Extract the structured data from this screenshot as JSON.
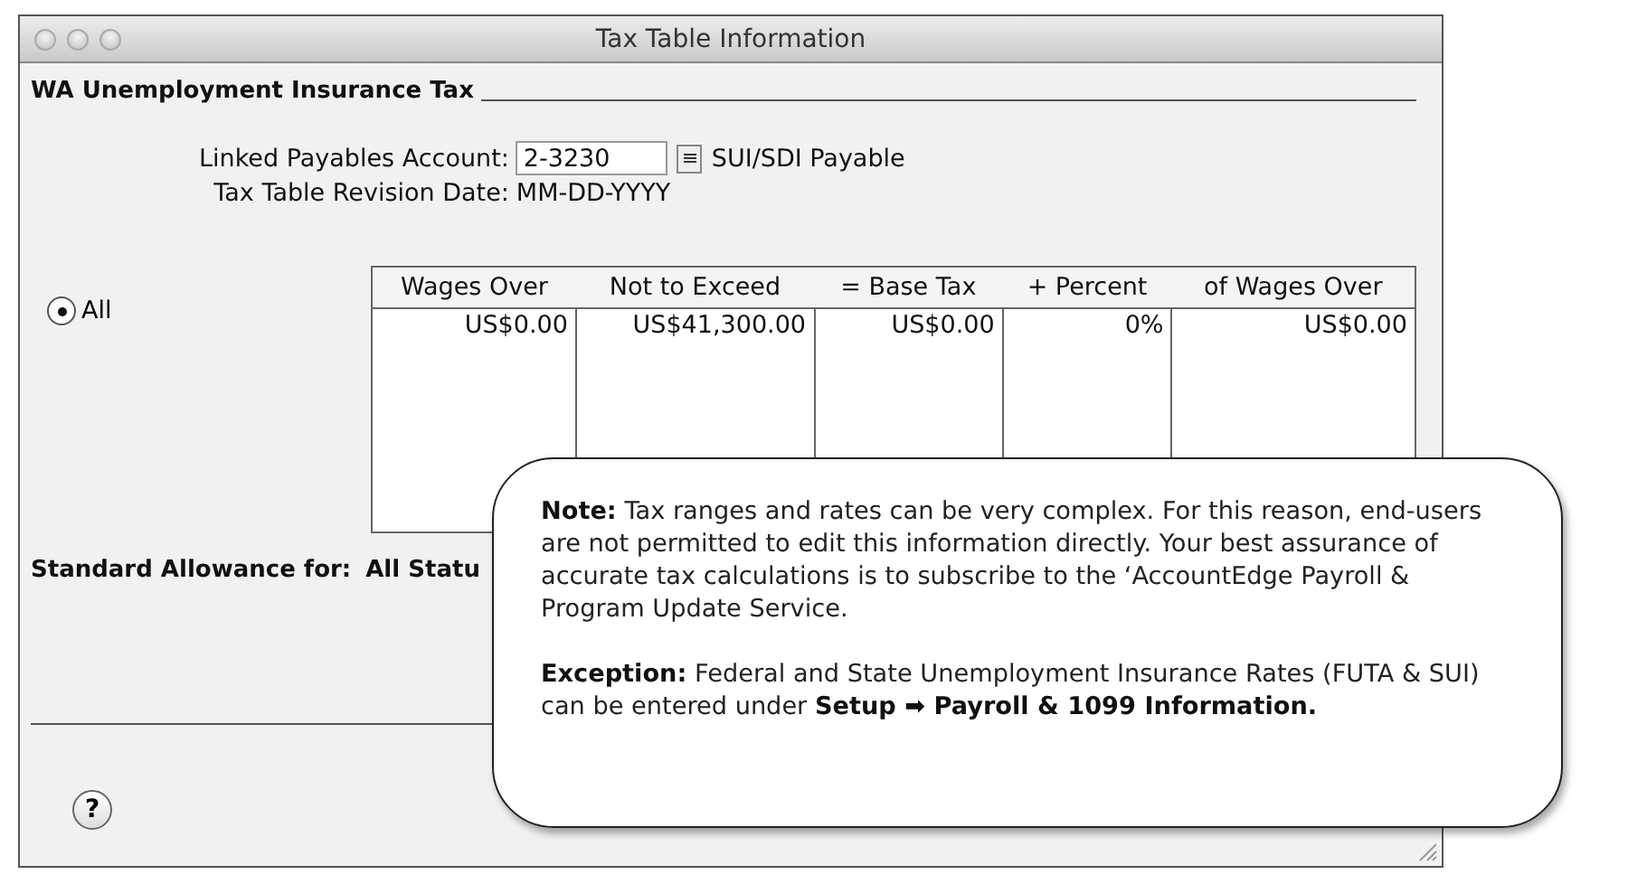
{
  "window": {
    "title": "Tax Table Information"
  },
  "section_title": "WA Unemployment Insurance Tax",
  "linked_account": {
    "label": "Linked Payables Account:",
    "value": "2-3230",
    "account_name": "SUI/SDI Payable"
  },
  "revision_date": {
    "label": "Tax Table Revision Date:",
    "value": "MM-DD-YYYY"
  },
  "filter_options": [
    {
      "label": "All",
      "selected": true
    }
  ],
  "table": {
    "columns": [
      "Wages Over",
      "Not to Exceed",
      "= Base Tax",
      "+ Percent",
      "of Wages Over"
    ],
    "rows": [
      [
        "US$0.00",
        "US$41,300.00",
        "US$0.00",
        "0%",
        "US$0.00"
      ]
    ]
  },
  "standard_allowance": {
    "label": "Standard Allowance for:",
    "value": "All Statu"
  },
  "help_button": "?",
  "callout": {
    "paragraphs": [
      "**Note:** Tax ranges and rates can be very complex. For this reason, end-users are not permitted to edit this information directly. Your best assurance of accurate tax calculations is to subscribe to the ‘AccountEdge Payroll & Program Update Service.",
      "**Exception:** Federal and State Unemployment Insurance Rates (FUTA & SUI) can be entered under **Setup ➡ Payroll & 1099 Information.**"
    ]
  }
}
